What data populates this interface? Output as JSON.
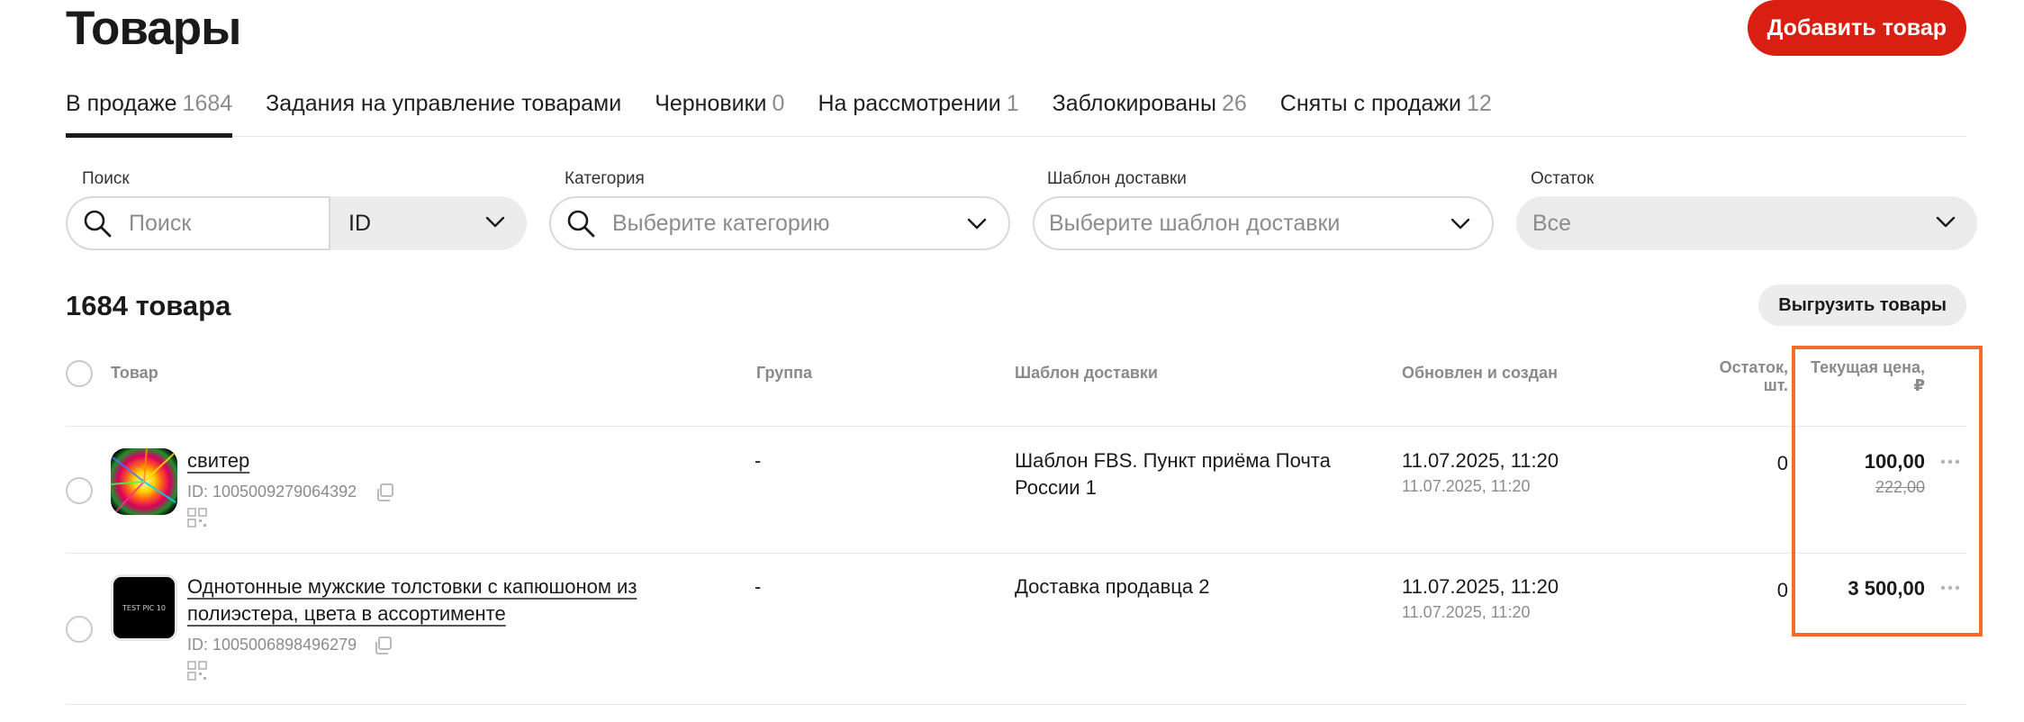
{
  "header": {
    "title": "Товары",
    "add_button": "Добавить товар"
  },
  "tabs": [
    {
      "label": "В продаже",
      "count": "1684",
      "active": true
    },
    {
      "label": "Задания на управление товарами",
      "count": ""
    },
    {
      "label": "Черновики",
      "count": "0"
    },
    {
      "label": "На рассмотрении",
      "count": "1"
    },
    {
      "label": "Заблокированы",
      "count": "26"
    },
    {
      "label": "Сняты с продажи",
      "count": "12"
    }
  ],
  "filters": {
    "search": {
      "label": "Поиск",
      "placeholder": "Поиск",
      "type_value": "ID"
    },
    "category": {
      "label": "Категория",
      "placeholder": "Выберите категорию"
    },
    "delivery": {
      "label": "Шаблон доставки",
      "placeholder": "Выберите шаблон доставки"
    },
    "stock": {
      "label": "Остаток",
      "value": "Все"
    }
  },
  "list": {
    "count_title": "1684 товара",
    "export_button": "Выгрузить товары"
  },
  "table": {
    "columns": {
      "product": "Товар",
      "group": "Группа",
      "delivery": "Шаблон доставки",
      "updated": "Обновлен и создан",
      "stock_line1": "Остаток,",
      "stock_line2": "шт.",
      "price_line1": "Текущая цена,",
      "price_line2": "₽"
    },
    "rows": [
      {
        "name": "свитер",
        "id": "ID: 1005009279064392",
        "group": "-",
        "delivery": "Шаблон FBS. Пункт приёма Почта России 1",
        "updated": "11.07.2025, 11:20",
        "created": "11.07.2025, 11:20",
        "stock": "0",
        "price": "100,00",
        "old_price": "222,00"
      },
      {
        "name": "Однотонные мужские толстовки с капюшоном из полиэстера, цвета в ассортименте",
        "id": "ID: 1005006898496279",
        "group": "-",
        "delivery": "Доставка продавца 2",
        "updated": "11.07.2025, 11:20",
        "created": "11.07.2025, 11:20",
        "stock": "0",
        "price": "3 500,00",
        "thumb_text": "TEST PIC 10"
      }
    ]
  },
  "colors": {
    "accent": "#d91f12",
    "highlight": "#f26d2b"
  }
}
